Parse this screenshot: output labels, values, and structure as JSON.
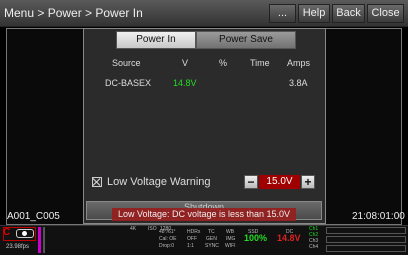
{
  "header": {
    "breadcrumb": "Menu > Power > Power In",
    "buttons": [
      "...",
      "Help",
      "Back",
      "Close"
    ]
  },
  "viewport": {
    "clip_name": "A001_C005",
    "timecode": "21:08:01:00"
  },
  "dialog": {
    "tabs": {
      "active": "Power In",
      "inactive": "Power Save"
    },
    "table": {
      "headers": [
        "Source",
        "V",
        "%",
        "Time",
        "Amps"
      ],
      "rows": [
        {
          "source": "DC-BASEX",
          "volts": "14.8V",
          "percent": "",
          "time": "",
          "amps": "3.8A"
        }
      ]
    },
    "low_voltage": {
      "label": "Low Voltage Warning",
      "checked": true,
      "minus": "−",
      "value": "15.0V",
      "plus": "+"
    },
    "shutdown_label": "Shutdown",
    "warning": "Low Voltage: DC voltage is less than 15.0V"
  },
  "statusbar": {
    "fps": "23.98fps",
    "iso_row": [
      "4K",
      "ISO",
      "1280"
    ],
    "lens_row": [
      "48°/61°",
      "HDRx",
      "TC",
      "WB",
      "SSD"
    ],
    "cal_row": [
      "Cal: OE",
      "OFF",
      "GEN",
      "IMG"
    ],
    "drop_row": [
      "Drop:0",
      "1:1",
      "SYNC",
      "WIFI"
    ],
    "ssd_percent": "100%",
    "dc_label": "DC",
    "dc_voltage": "14.8V",
    "channels": [
      "Ch1",
      "Ch2",
      "Ch3",
      "Ch4"
    ],
    "colors": {
      "green": "#22dd22",
      "red": "#dd2222",
      "accent": "#a00000"
    }
  }
}
